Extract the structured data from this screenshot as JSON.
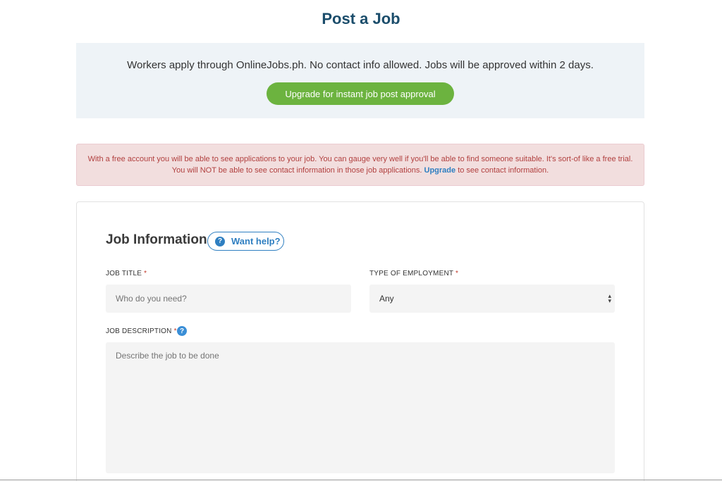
{
  "page": {
    "title": "Post a Job"
  },
  "info_panel": {
    "text": "Workers apply through OnlineJobs.ph. No contact info allowed. Jobs will be approved within 2 days.",
    "upgrade_button": "Upgrade for instant job post approval"
  },
  "alert": {
    "line1": "With a free account you will be able to see applications to your job. You can gauge very well if you'll be able to find someone suitable. It's sort-of like a free trial.",
    "line2_before": "You will NOT be able to see contact information in those job applications.",
    "link": "Upgrade",
    "line2_after": "to see contact information."
  },
  "form": {
    "section_title": "Job Information",
    "help_button": "Want help?",
    "required_mark": "*",
    "job_title": {
      "label": "JOB TITLE",
      "placeholder": "Who do you need?"
    },
    "employment_type": {
      "label": "TYPE OF EMPLOYMENT",
      "value": "Any"
    },
    "job_description": {
      "label": "JOB DESCRIPTION",
      "placeholder": "Describe the job to be done"
    }
  },
  "icons": {
    "help": "question-circle-icon",
    "select_arrow": "up-down-chevron-icon"
  },
  "colors": {
    "title": "#1b4d6b",
    "upgrade_green": "#6cb33f",
    "alert_bg": "#f2dede",
    "alert_text": "#b1403f",
    "link_blue": "#2f7fc1",
    "required_red": "#c0392b"
  }
}
